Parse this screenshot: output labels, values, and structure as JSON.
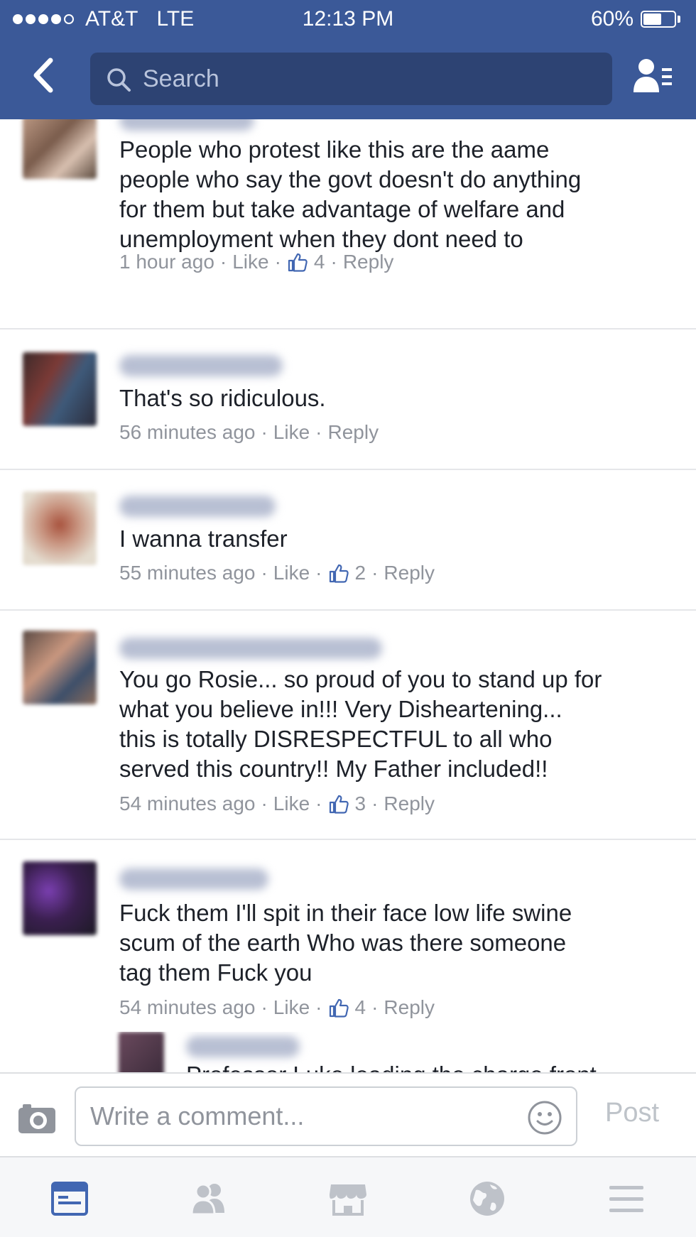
{
  "status_bar": {
    "carrier": "AT&T",
    "network": "LTE",
    "time": "12:13 PM",
    "battery": "60%",
    "battery_level": 0.6
  },
  "nav": {
    "search_placeholder": "Search",
    "back_icon": "chevron-left-icon",
    "friends_icon": "friend-requests-icon"
  },
  "comments": [
    {
      "text": "People who protest like this are the aame\npeople who say the govt doesn't do anything\nfor them but take advantage of welfare and\nunemployment when they dont need to",
      "time": "1 hour ago",
      "like": "Like",
      "likes": "4",
      "reply": "Reply"
    },
    {
      "text": "That's so ridiculous.",
      "time": "56 minutes ago",
      "like": "Like",
      "likes": "",
      "reply": "Reply"
    },
    {
      "text": "I wanna transfer",
      "time": "55 minutes ago",
      "like": "Like",
      "likes": "2",
      "reply": "Reply"
    },
    {
      "text": "You go Rosie... so proud of you to stand up for\nwhat you believe in!!! Very Disheartening...\nthis is totally DISRESPECTFUL to all who\nserved this country!! My Father included!!",
      "time": "54 minutes ago",
      "like": "Like",
      "likes": "3",
      "reply": "Reply"
    },
    {
      "text": "Fuck them I'll spit in their face low life swine\nscum of the earth Who was there someone\ntag them Fuck you",
      "time": "54 minutes ago",
      "like": "Like",
      "likes": "4",
      "reply": "Reply"
    }
  ],
  "partial_reply": {
    "text": "Professor Luke leading the charge front"
  },
  "composer": {
    "placeholder": "Write a comment...",
    "post": "Post",
    "camera_icon": "camera-icon",
    "emoji_icon": "emoji-icon"
  },
  "tabs": [
    {
      "name": "news-feed-icon",
      "active": true
    },
    {
      "name": "friends-icon",
      "active": false
    },
    {
      "name": "marketplace-icon",
      "active": false
    },
    {
      "name": "notifications-globe-icon",
      "active": false
    },
    {
      "name": "menu-icon",
      "active": false
    }
  ],
  "colors": {
    "brand": "#3b5998",
    "search_bg": "#2d4373",
    "meta_text": "#90949c",
    "tab_active": "#4267b2",
    "tab_inactive": "#bec2c9"
  }
}
